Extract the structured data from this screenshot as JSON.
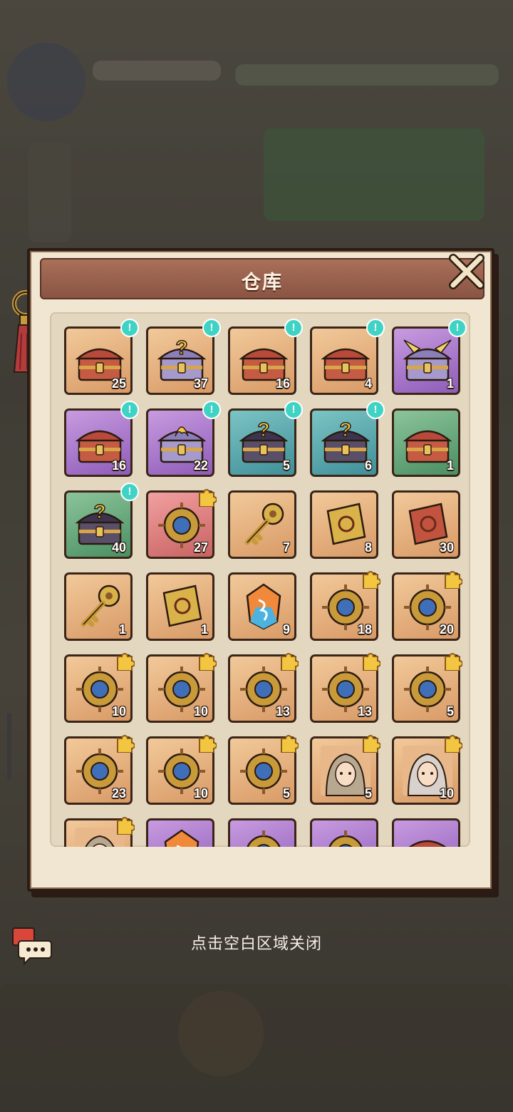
{
  "window": {
    "title": "仓库",
    "close_hint": "点击空白区域关闭"
  },
  "colors": {
    "orange": "#e0a672",
    "purple": "#a777cc",
    "teal": "#57a9ae",
    "green": "#66a97a",
    "red": "#de8383",
    "badge": "#3fd3c5"
  },
  "items": [
    {
      "icon": "red-treasure-chest-icon",
      "bg": "orange",
      "count": "25",
      "badge": "!"
    },
    {
      "icon": "mystery-purple-chest-icon",
      "bg": "orange",
      "count": "37",
      "badge": "!"
    },
    {
      "icon": "ornate-chest-icon",
      "bg": "orange",
      "count": "16",
      "badge": "!"
    },
    {
      "icon": "ornate-chest-icon",
      "bg": "orange",
      "count": "4",
      "badge": "!"
    },
    {
      "icon": "winged-chest-icon",
      "bg": "purple",
      "count": "1",
      "badge": "!"
    },
    {
      "icon": "ornate-chest-icon",
      "bg": "purple",
      "count": "16",
      "badge": "!"
    },
    {
      "icon": "flame-chest-icon",
      "bg": "purple",
      "count": "22",
      "badge": "!"
    },
    {
      "icon": "mystery-chest-icon",
      "bg": "teal",
      "count": "5",
      "badge": "!"
    },
    {
      "icon": "mystery-chest-icon",
      "bg": "teal",
      "count": "6",
      "badge": "!"
    },
    {
      "icon": "ornate-chest-icon",
      "bg": "green",
      "count": "1",
      "badge": ""
    },
    {
      "icon": "mystery-chest-icon",
      "bg": "green",
      "count": "40",
      "badge": "!"
    },
    {
      "icon": "bronze-cauldron-icon",
      "bg": "red",
      "count": "27",
      "badge": "",
      "puzzle": true
    },
    {
      "icon": "golden-key-icon",
      "bg": "orange",
      "count": "7",
      "badge": ""
    },
    {
      "icon": "spoon-tablet-icon",
      "bg": "orange",
      "count": "8",
      "badge": ""
    },
    {
      "icon": "red-scroll-icon",
      "bg": "orange",
      "count": "30",
      "badge": ""
    },
    {
      "icon": "brass-key-icon",
      "bg": "orange",
      "count": "1",
      "badge": ""
    },
    {
      "icon": "golden-token-icon",
      "bg": "orange",
      "count": "1",
      "badge": ""
    },
    {
      "icon": "rainbow-gem-icon",
      "bg": "orange",
      "count": "9",
      "badge": ""
    },
    {
      "icon": "pagoda-fragment-icon",
      "bg": "orange",
      "count": "18",
      "badge": "",
      "puzzle": true
    },
    {
      "icon": "golden-axe-fragment-icon",
      "bg": "orange",
      "count": "20",
      "badge": "",
      "puzzle": true
    },
    {
      "icon": "jade-fan-fragment-icon",
      "bg": "orange",
      "count": "10",
      "badge": "",
      "puzzle": true
    },
    {
      "icon": "blue-orb-fragment-icon",
      "bg": "orange",
      "count": "10",
      "badge": "",
      "puzzle": true
    },
    {
      "icon": "fire-wheel-fragment-icon",
      "bg": "orange",
      "count": "13",
      "badge": "",
      "puzzle": true
    },
    {
      "icon": "incense-burner-fragment-icon",
      "bg": "orange",
      "count": "13",
      "badge": "",
      "puzzle": true
    },
    {
      "icon": "sword-fragment-icon",
      "bg": "orange",
      "count": "5",
      "badge": "",
      "puzzle": true
    },
    {
      "icon": "amulet-fragment-icon",
      "bg": "orange",
      "count": "23",
      "badge": "",
      "puzzle": true
    },
    {
      "icon": "silver-mirror-fragment-icon",
      "bg": "orange",
      "count": "10",
      "badge": "",
      "puzzle": true
    },
    {
      "icon": "scales-fragment-icon",
      "bg": "orange",
      "count": "5",
      "badge": "",
      "puzzle": true
    },
    {
      "icon": "hero-portrait-fragment-icon",
      "bg": "orange",
      "count": "5",
      "badge": "",
      "puzzle": true
    },
    {
      "icon": "heroine-portrait-fragment-icon",
      "bg": "orange",
      "count": "10",
      "badge": "",
      "puzzle": true
    },
    {
      "icon": "hero-portrait-fragment-icon",
      "bg": "orange",
      "count": "",
      "badge": "",
      "puzzle": true
    },
    {
      "icon": "crystal-icon",
      "bg": "purple",
      "count": "",
      "badge": ""
    },
    {
      "icon": "compass-icon",
      "bg": "purple",
      "count": "",
      "badge": ""
    },
    {
      "icon": "medal-icon",
      "bg": "purple",
      "count": "",
      "badge": ""
    },
    {
      "icon": "red-chest-icon",
      "bg": "purple",
      "count": "",
      "badge": ""
    }
  ]
}
